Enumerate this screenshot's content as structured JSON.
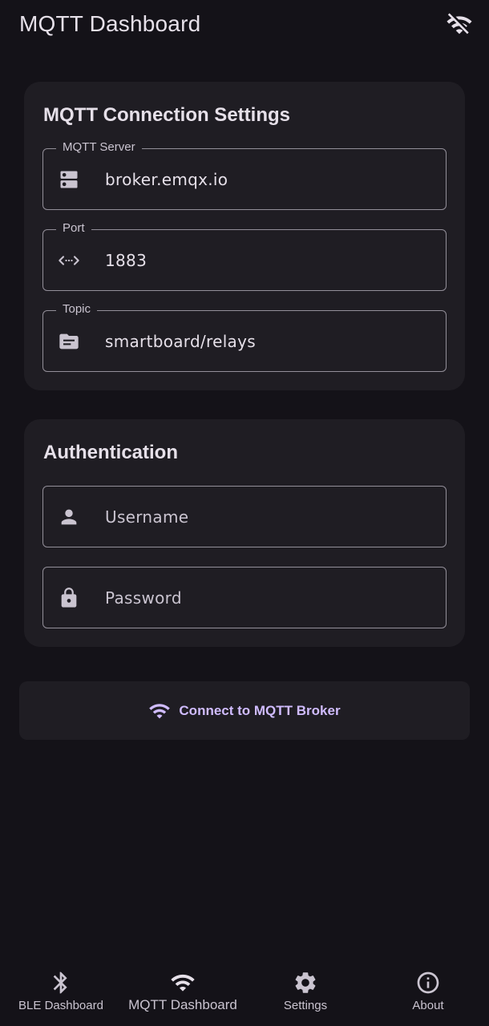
{
  "appbar": {
    "title": "MQTT Dashboard",
    "status_icon": "wifi-off-icon"
  },
  "connection_card": {
    "title": "MQTT Connection Settings",
    "fields": [
      {
        "label": "MQTT Server",
        "value": "broker.emqx.io",
        "icon": "server-icon"
      },
      {
        "label": "Port",
        "value": "1883",
        "icon": "code-icon"
      },
      {
        "label": "Topic",
        "value": "smartboard/relays",
        "icon": "description-icon"
      }
    ]
  },
  "auth_card": {
    "title": "Authentication",
    "username": {
      "placeholder": "Username",
      "value": "",
      "icon": "person-icon"
    },
    "password": {
      "placeholder": "Password",
      "value": "",
      "icon": "lock-icon"
    }
  },
  "connect_button": {
    "label": "Connect to MQTT Broker",
    "icon": "wifi-icon"
  },
  "bottom_nav": {
    "items": [
      {
        "label": "BLE Dashboard",
        "icon": "bluetooth-icon",
        "active": false
      },
      {
        "label": "MQTT Dashboard",
        "icon": "wifi-icon",
        "active": true
      },
      {
        "label": "Settings",
        "icon": "gear-icon",
        "active": false
      },
      {
        "label": "About",
        "icon": "info-icon",
        "active": false
      }
    ]
  },
  "colors": {
    "background": "#141218",
    "surface": "#1F1D23",
    "accent": "#D0BCFF",
    "text": "#E6E0E9",
    "muted": "#CAC4D0",
    "outline": "#938F99"
  }
}
